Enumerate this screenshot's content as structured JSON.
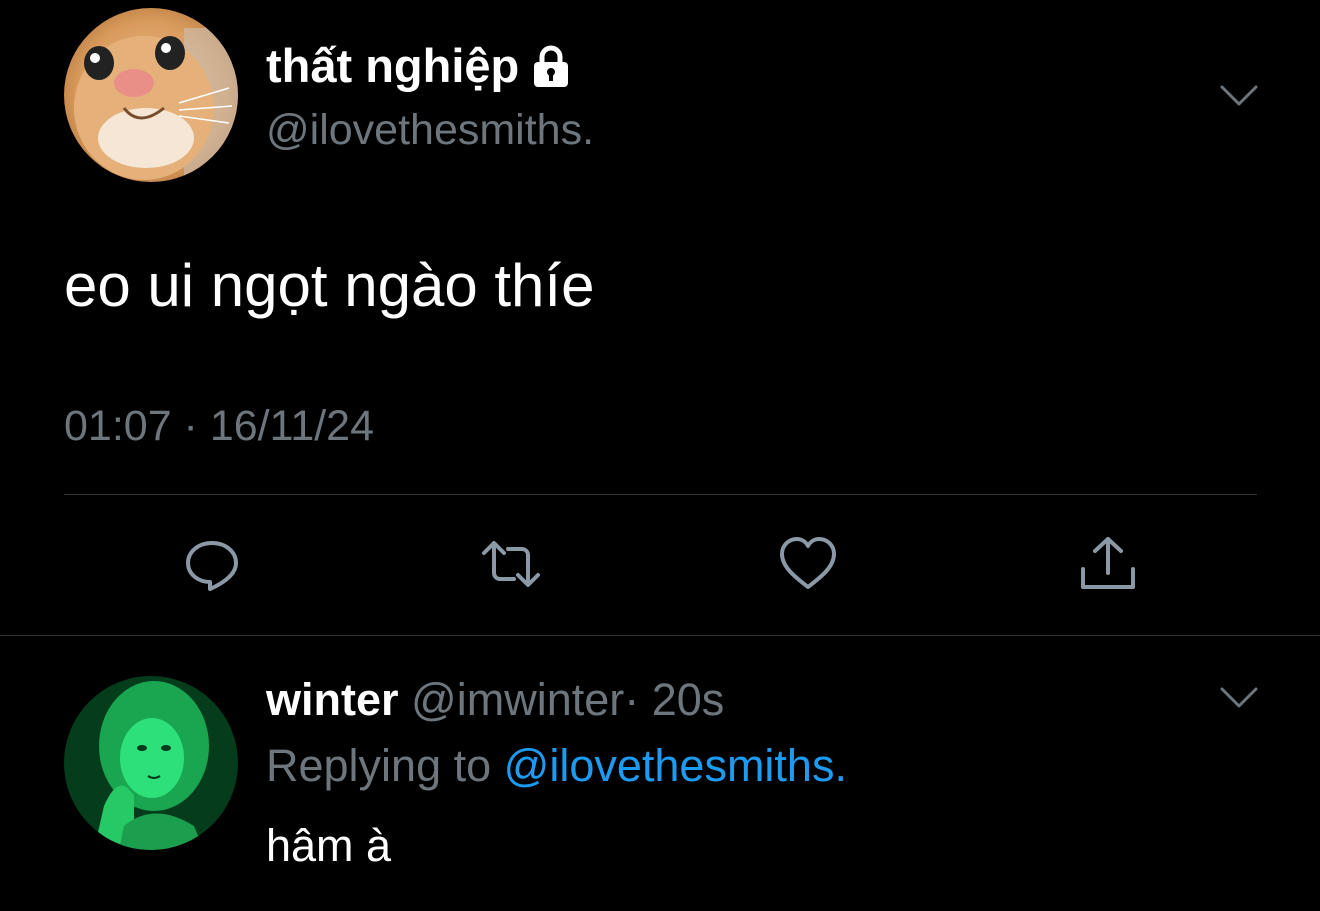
{
  "colors": {
    "background": "#000000",
    "primary_text": "#ffffff",
    "secondary_text": "#6e767d",
    "divider": "#2f3336",
    "link": "#1d9bf0",
    "icon": "#8b98a5"
  },
  "main_tweet": {
    "avatar_icon": "cat-avatar",
    "display_name": "thất nghiệp",
    "protected_icon": "lock-icon",
    "handle": "@ilovethesmiths.",
    "text": "eo ui ngọt ngào thíe",
    "timestamp": "01:07 · 16/11/24",
    "actions": [
      {
        "name": "reply",
        "icon": "reply-icon"
      },
      {
        "name": "retweet",
        "icon": "retweet-icon"
      },
      {
        "name": "like",
        "icon": "heart-icon"
      },
      {
        "name": "share",
        "icon": "share-icon"
      }
    ]
  },
  "reply_tweet": {
    "avatar_icon": "green-portrait-avatar",
    "display_name": "winter",
    "handle": "@imwinter",
    "time": "· 20s",
    "replying_label": "Replying to",
    "replying_to": "@ilovethesmiths.",
    "text": "hâm à"
  }
}
